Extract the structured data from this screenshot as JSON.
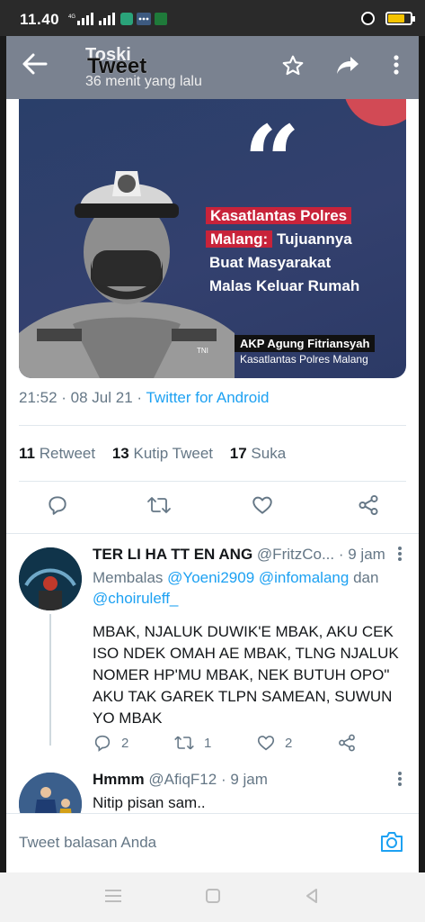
{
  "status_bar": {
    "time": "11.40",
    "signal_1": "4G",
    "signal_2": "",
    "battery_color": "#f5c400"
  },
  "app_bar": {
    "title": "Tweet",
    "ghost_title": "Toski",
    "subtitle": "36 menit yang lalu",
    "background": "#7a8290"
  },
  "tweet_image": {
    "headline_line1": "Kasatlantas Polres",
    "headline_line2_red": "Malang:",
    "headline_line2_rest": " Tujuannya",
    "headline_line3": "Buat Masyarakat",
    "headline_line4": "Malas Keluar Rumah",
    "name": "AKP Agung Fitriansyah",
    "title": "Kasatlantas Polres Malang",
    "quote_mark": "“",
    "badge_text": "TNI"
  },
  "tweet_meta": {
    "time": "21:52",
    "date": "08 Jul 21",
    "client": "Twitter for Android"
  },
  "stats": {
    "retweets": "11",
    "retweets_label": "Retweet",
    "quotes": "13",
    "quotes_label": "Kutip Tweet",
    "likes": "17",
    "likes_label": "Suka"
  },
  "replies": [
    {
      "name": "TER LI HA TT EN ANG",
      "handle": "@FritzCo...",
      "time": "· 9 jam",
      "replying_label": "Membalas",
      "mention1": "@Yoeni2909",
      "mention2": "@infomalang",
      "and": "dan",
      "mention3": "@choiruleff_",
      "text": "MBAK, NJALUK DUWIK'E MBAK, AKU CEK ISO NDEK OMAH AE MBAK, TLNG NJALUK NOMER HP'MU MBAK, NEK BUTUH OPO\" AKU TAK GAREK TLPN SAMEAN, SUWUN YO MBAK",
      "reply_count": "2",
      "retweet_count": "1",
      "like_count": "2"
    },
    {
      "name": "Hmmm",
      "handle": "@AfiqF12",
      "time": "· 9 jam",
      "text": "Nitip pisan sam.."
    }
  ],
  "compose": {
    "placeholder": "Tweet balasan Anda"
  },
  "colors": {
    "accent": "#1da1f2",
    "secondary_text": "#657786",
    "headline_red": "#c8233a"
  }
}
